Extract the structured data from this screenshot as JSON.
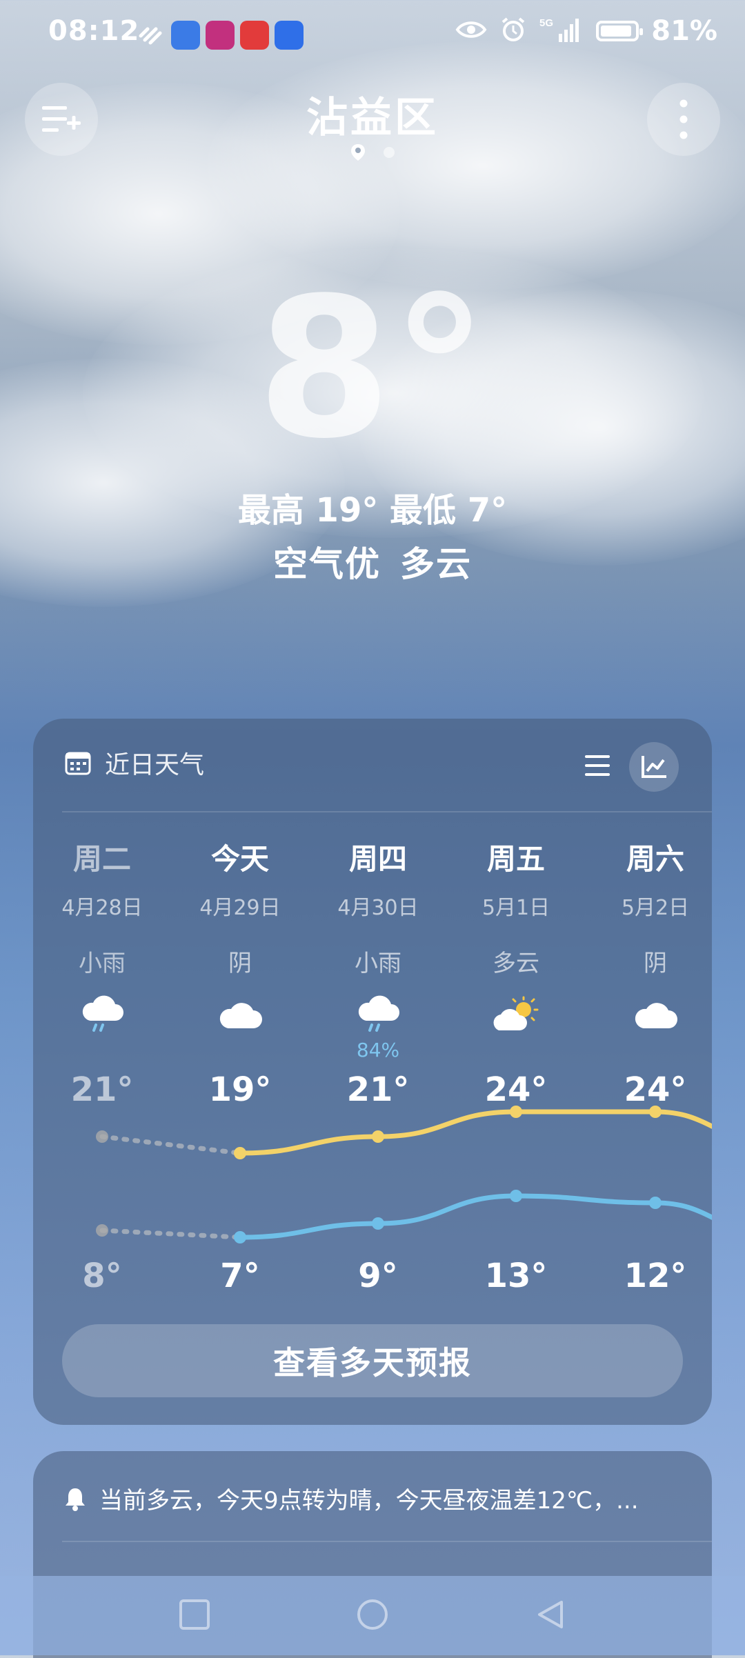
{
  "status_bar": {
    "time": "08:12",
    "battery_percent": "81%",
    "network": "5G"
  },
  "header": {
    "city": "沾益区"
  },
  "current": {
    "temperature": "8°",
    "hi_lo": "最高 19° 最低 7°",
    "air_quality": "空气优",
    "condition": "多云"
  },
  "forecast": {
    "title": "近日天气",
    "days": [
      {
        "day": "周二",
        "date": "4月28日",
        "desc": "小雨",
        "icon": "rain-cloud-icon",
        "prob": "",
        "hi": "21°",
        "lo": "8°"
      },
      {
        "day": "今天",
        "date": "4月29日",
        "desc": "阴",
        "icon": "cloud-icon",
        "prob": "",
        "hi": "19°",
        "lo": "7°"
      },
      {
        "day": "周四",
        "date": "4月30日",
        "desc": "小雨",
        "icon": "rain-cloud-icon",
        "prob": "84%",
        "hi": "21°",
        "lo": "9°"
      },
      {
        "day": "周五",
        "date": "5月1日",
        "desc": "多云",
        "icon": "partly-sunny-icon",
        "prob": "",
        "hi": "24°",
        "lo": "13°"
      },
      {
        "day": "周六",
        "date": "5月2日",
        "desc": "阴",
        "icon": "cloud-icon",
        "prob": "",
        "hi": "24°",
        "lo": "12°"
      }
    ],
    "more_button": "查看多天预报"
  },
  "chart_data": {
    "type": "line",
    "categories": [
      "周二",
      "今天",
      "周四",
      "周五",
      "周六"
    ],
    "series": [
      {
        "values": [
          21,
          19,
          21,
          24,
          24
        ]
      },
      {
        "values": [
          8,
          7,
          9,
          13,
          12
        ]
      }
    ],
    "colors": [
      "#f3d269",
      "#6fbfe8"
    ]
  },
  "alert": {
    "text": "当前多云，今天9点转为晴，今天昼夜温差12℃，..."
  }
}
